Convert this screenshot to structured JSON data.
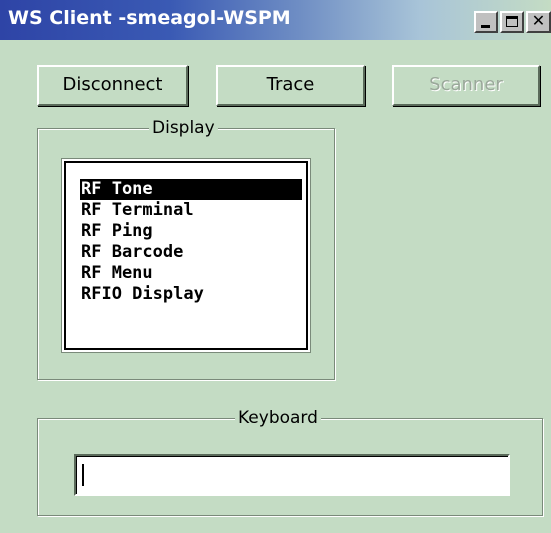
{
  "window": {
    "title": "WS Client -smeagol-WSPM",
    "controls": {
      "minimize_icon": "minimize-icon",
      "maximize_icon": "maximize-icon",
      "close_icon": "close-icon",
      "close_glyph": "✕"
    }
  },
  "toolbar": {
    "disconnect_label": "Disconnect",
    "trace_label": "Trace",
    "scanner_label": "Scanner",
    "scanner_enabled": false
  },
  "display": {
    "label": "Display",
    "items": [
      {
        "label": "RF Tone",
        "selected": true
      },
      {
        "label": "RF Terminal",
        "selected": false
      },
      {
        "label": "RF Ping",
        "selected": false
      },
      {
        "label": "RF Barcode",
        "selected": false
      },
      {
        "label": "RF Menu",
        "selected": false
      },
      {
        "label": "RFIO Display",
        "selected": false
      }
    ]
  },
  "keyboard": {
    "label": "Keyboard",
    "value": ""
  },
  "colors": {
    "window_bg": "#c4dcc4",
    "title_gradient_start": "#2e44a6",
    "selection_bg": "#000000"
  }
}
